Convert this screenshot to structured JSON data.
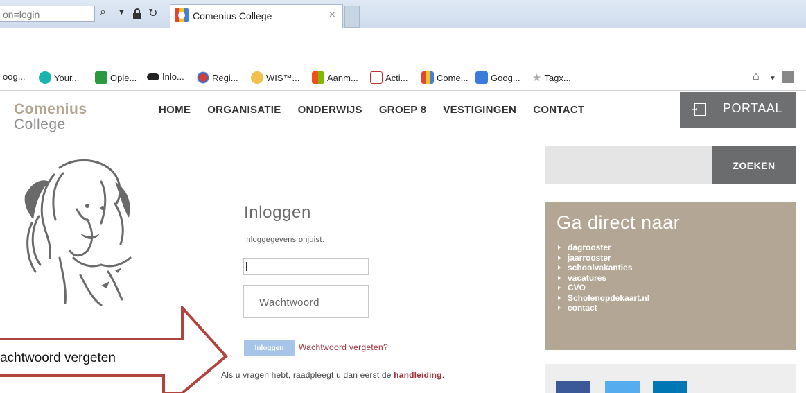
{
  "browser": {
    "address_text": "on=login",
    "tab_title": "Comenius College",
    "tab_close": "×",
    "bookmarks": [
      "oog...",
      "Your...",
      "Ople...",
      "Inlo...",
      "Regi...",
      "WIS™...",
      "Aanm...",
      "Acti...",
      "Come...",
      "Goog...",
      "Tagx..."
    ]
  },
  "header": {
    "logo_line1": "Comenius",
    "logo_line2": "College",
    "nav": [
      "HOME",
      "ORGANISATIE",
      "ONDERWIJS",
      "GROEP 8",
      "VESTIGINGEN",
      "CONTACT"
    ],
    "portaal_label": "PORTAAL"
  },
  "sidebar": {
    "search_button": "ZOEKEN",
    "direct_title": "Ga direct naar",
    "direct_links": [
      "dagrooster",
      "jaarrooster",
      "schoolvakanties",
      "vacatures",
      "CVO",
      "Scholenopdekaart.nl",
      "contact"
    ]
  },
  "login": {
    "title": "Inloggen",
    "error": "Inloggegevens onjuist.",
    "username_value": "",
    "password_placeholder": "Wachtwoord",
    "submit_label": "Inloggen",
    "forgot_link": "Wachtwoord vergeten?",
    "help_prefix": "Als u vragen hebt, raadpleegt u dan eerst de ",
    "help_link": "handleiding",
    "help_suffix": "."
  },
  "annotation": {
    "arrow_label": "achtwoord vergeten"
  },
  "colors": {
    "brand_beige": "#b3a694",
    "dark_gray": "#6e6f71",
    "link_red": "#a3323c",
    "button_blue": "#a7c5e8",
    "arrow_red": "#b0443f"
  }
}
